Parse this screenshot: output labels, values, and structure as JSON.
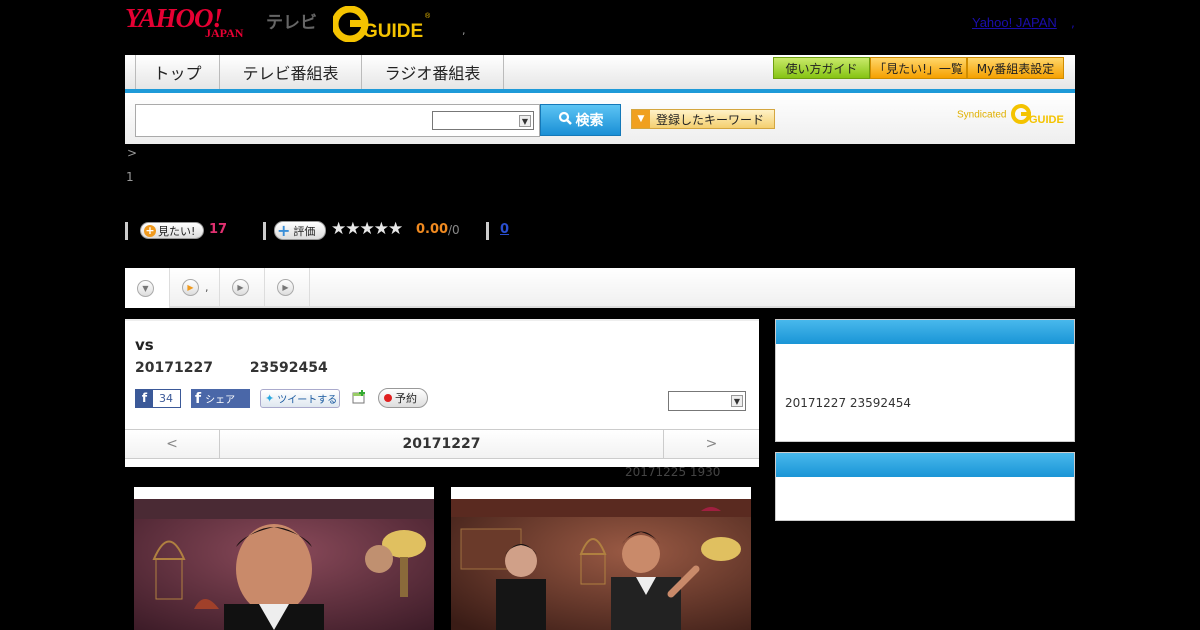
{
  "header": {
    "yahoo_logo": "YAHOO!",
    "japan_logo": "JAPAN",
    "tv_label": "テレビ",
    "gguide_logo": "GUIDE",
    "separator": ",",
    "yahoo_japan_link": "Yahoo! JAPAN",
    "link_comma": ","
  },
  "nav": {
    "tabs": [
      "トップ",
      "テレビ番組表",
      "ラジオ番組表"
    ],
    "guide_buttons": [
      "使い方ガイド",
      "「見たい!」一覧",
      "My番組表設定"
    ]
  },
  "search": {
    "input_value": "",
    "select_value": "",
    "search_button": "検索",
    "keyword_button": "登録したキーワード",
    "syndicated": "Syndicated"
  },
  "breadcrumb": {
    "line1": ">",
    "line2": "1"
  },
  "stats": {
    "want_label": "見たい!",
    "want_count": "17",
    "rate_label": "評価",
    "stars": "★★★★★",
    "score": "0.00",
    "score_total": "/0",
    "review_count": "0"
  },
  "subtabs": {
    "tab2_text": ","
  },
  "program": {
    "title": "vs",
    "date": "20171227",
    "time": "23592454",
    "fb_count": "34",
    "fb_share": "シェア",
    "tweet": "ツイートする",
    "reserve": "予約",
    "select_value": "",
    "nav_prev": "<",
    "nav_date": "20171227",
    "nav_next": ">",
    "broadcast_info": "20171225  1930"
  },
  "sidebar": {
    "box1_text": "20171227  23592454"
  },
  "colors": {
    "accent_blue": "#1e9ad8",
    "yahoo_red": "#e60033",
    "gguide_yellow": "#f4c300",
    "want_pink": "#e03070",
    "score_orange": "#f08a20"
  }
}
